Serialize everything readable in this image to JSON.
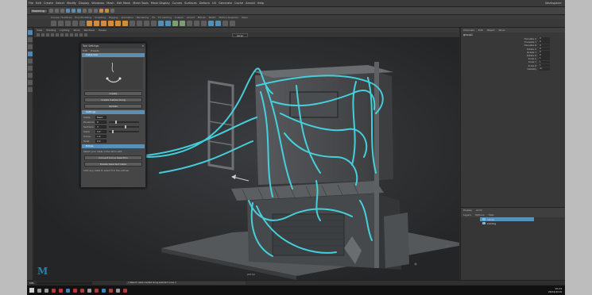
{
  "window": {
    "menus": [
      "File",
      "Edit",
      "Create",
      "Select",
      "Modify",
      "Display",
      "Windows",
      "Mesh",
      "Edit Mesh",
      "Mesh Tools",
      "Mesh Display",
      "Curves",
      "Surfaces",
      "Deform",
      "UV",
      "Generate",
      "Cache",
      "Arnold",
      "Help"
    ],
    "workspace_label": "Workspace:"
  },
  "status_line": {
    "mode": "Modeling"
  },
  "shelf_tabs": [
    "Curves / Surfaces",
    "Poly Modeling",
    "Sculpting",
    "Rigging",
    "Animation",
    "Rendering",
    "FX",
    "FX Caching",
    "Custom",
    "Arnold",
    "Bifrost",
    "MASH",
    "Motion Graphics",
    "XGen"
  ],
  "viewport": {
    "menus": [
      "View",
      "Shading",
      "Lighting",
      "Show",
      "Renderer",
      "Panels"
    ],
    "camera": "persp",
    "label": "persp"
  },
  "tool_panel": {
    "title": "Tool Settings",
    "menus": [
      "Edit",
      "Presets"
    ],
    "section1": "Cable tool",
    "btn1": "Create",
    "btn2": "Create Cables Along",
    "btn3": "Update",
    "section2": "Settings",
    "rows": [
      {
        "label": "Cable",
        "value": "Mesh"
      },
      {
        "label": "Divisions",
        "value": "8"
      },
      {
        "label": "Sections",
        "value": "3"
      },
      {
        "label": "Slack",
        "value": "0.0"
      },
      {
        "label": "Curve",
        "value": "1.0"
      },
      {
        "label": "Twist",
        "value": "0.0"
      }
    ],
    "section3": "Extras",
    "note1": "Select your cable in the list to edit.",
    "btn4": "Convert Curve Selection",
    "btn5": "Delete Selected Cable",
    "note2": "Click any cable to select it in the outliner."
  },
  "right_panel": {
    "tabs": [
      "Channels",
      "Edit",
      "Object",
      "Show"
    ],
    "object_name": "group1",
    "channels": [
      {
        "name": "Translate X",
        "value": "0"
      },
      {
        "name": "Translate Y",
        "value": "0"
      },
      {
        "name": "Translate Z",
        "value": "0"
      },
      {
        "name": "Rotate X",
        "value": "0"
      },
      {
        "name": "Rotate Y",
        "value": "0"
      },
      {
        "name": "Rotate Z",
        "value": "0"
      },
      {
        "name": "Scale X",
        "value": "1"
      },
      {
        "name": "Scale Y",
        "value": "1"
      },
      {
        "name": "Scale Z",
        "value": "1"
      },
      {
        "name": "Visibility",
        "value": "on"
      }
    ],
    "layer_tabs": [
      "Display",
      "Anim"
    ],
    "layer_menu": [
      "Layers",
      "Options",
      "Help"
    ],
    "layers": [
      "cables",
      "building"
    ]
  },
  "command_line": {
    "label": "MEL",
    "message": "// Result: cable created along selected curve //"
  },
  "taskbar": {
    "time": "10:24",
    "date": "26/04/2019"
  },
  "colors": {
    "accent": "#5a8fb8",
    "cable": "#46d6e4",
    "viewport_bg": "#2a2a2a",
    "building": "#6b6e70"
  }
}
